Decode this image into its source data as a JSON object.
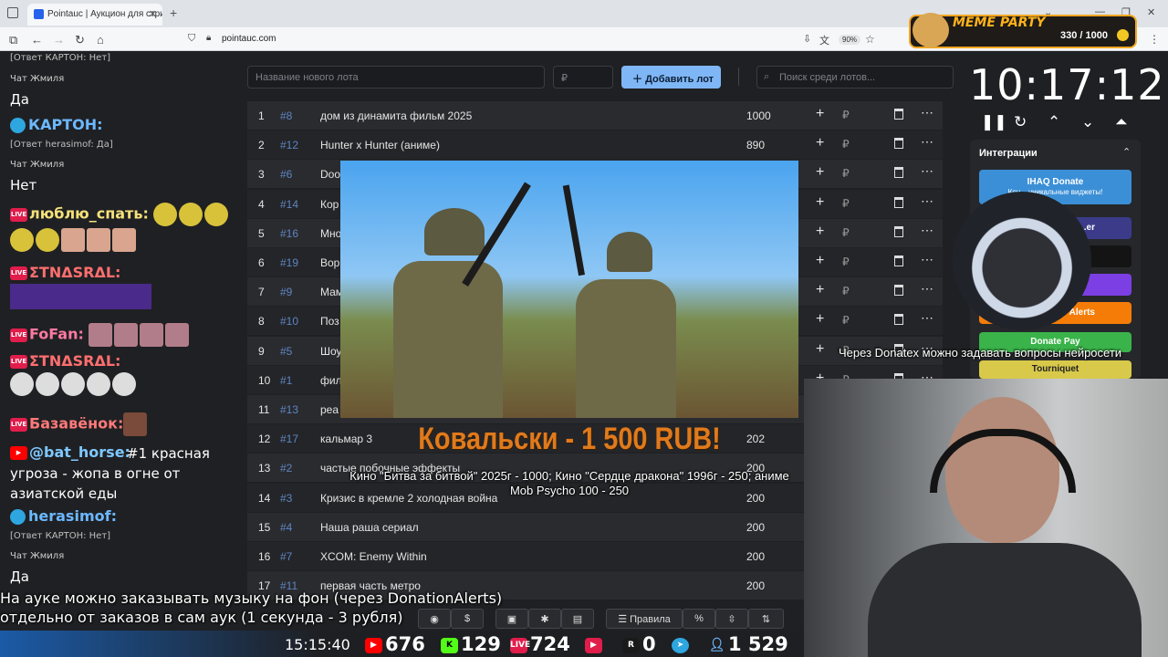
{
  "browser": {
    "tab_title": "Pointauc | Аукцион для стрим",
    "url": "pointauc.com",
    "zoom": "90%"
  },
  "meme_party": {
    "title": "MEME PARTY",
    "counter": "330 / 1000"
  },
  "form": {
    "lot_name_placeholder": "Название нового лота",
    "amount_placeholder": "₽",
    "add_button": "Добавить лот",
    "search_placeholder": "Поиск среди лотов..."
  },
  "lots": [
    {
      "idx": "1",
      "id": "#8",
      "name": "дом из динамита фильм 2025",
      "amount": "1000"
    },
    {
      "idx": "2",
      "id": "#12",
      "name": "Hunter x Hunter (аниме)",
      "amount": "890"
    },
    {
      "idx": "3",
      "id": "#6",
      "name": "Doo",
      "amount": ""
    },
    {
      "idx": "4",
      "id": "#14",
      "name": "Кор",
      "amount": ""
    },
    {
      "idx": "5",
      "id": "#16",
      "name": "Мно",
      "amount": ""
    },
    {
      "idx": "6",
      "id": "#19",
      "name": "Вор",
      "amount": ""
    },
    {
      "idx": "7",
      "id": "#9",
      "name": "Мам",
      "amount": ""
    },
    {
      "idx": "8",
      "id": "#10",
      "name": "Поз",
      "amount": ""
    },
    {
      "idx": "9",
      "id": "#5",
      "name": "Шоу",
      "amount": ""
    },
    {
      "idx": "10",
      "id": "#1",
      "name": "фил",
      "amount": ""
    },
    {
      "idx": "11",
      "id": "#13",
      "name": "реа",
      "amount": ""
    },
    {
      "idx": "12",
      "id": "#17",
      "name": "кальмар 3",
      "amount": "202"
    },
    {
      "idx": "13",
      "id": "#2",
      "name": "частые побочные эффекты",
      "amount": "200"
    },
    {
      "idx": "14",
      "id": "#3",
      "name": "Кризис в кремле 2 холодная война",
      "amount": "200"
    },
    {
      "idx": "15",
      "id": "#4",
      "name": "Наша раша сериал",
      "amount": "200"
    },
    {
      "idx": "16",
      "id": "#7",
      "name": "XCOM: Enemy Within",
      "amount": "200"
    },
    {
      "idx": "17",
      "id": "#11",
      "name": "первая часть метро",
      "amount": "200"
    }
  ],
  "currency_symbol": "₽",
  "donation": {
    "title": "Ковальски - 1 500 RUB!",
    "message": "Кино \"Битва за битвой\" 2025г - 1000; Кино \"Сердце дракона\" 1996г - 250; аниме Mob Psycho 100 - 250"
  },
  "timer": {
    "value": "10:17:12"
  },
  "integrations": {
    "title": "Интеграции",
    "buttons": [
      "IHAQ Donate",
      "Кон... уникальные виджеты!",
      "...er",
      "",
      "",
      "Alerts",
      "Donate Pay",
      "Tourniquet"
    ]
  },
  "overlay_question": "Через Donatex можно задавать вопросы нейросети",
  "chat": [
    {
      "type": "sys",
      "text": "[Ответ КАРТОН: Нет]"
    },
    {
      "type": "name",
      "text": "Чат Жмиля"
    },
    {
      "type": "msg",
      "text": "Да"
    },
    {
      "type": "user",
      "text": "КАРТОН:"
    },
    {
      "type": "sys",
      "text": "[Ответ herasimof: Да]"
    },
    {
      "type": "name",
      "text": "Чат Жмиля"
    },
    {
      "type": "msg",
      "text": "Нет"
    },
    {
      "type": "user",
      "text": "люблю_спать:"
    },
    {
      "type": "user",
      "text": "ΣTNΔSRΔL:"
    },
    {
      "type": "user",
      "text": "FoFan:"
    },
    {
      "type": "user",
      "text": "ΣTNΔSRΔL:"
    },
    {
      "type": "user",
      "text": "Базавёнок:"
    },
    {
      "type": "user",
      "text": "@bat_horse:"
    },
    {
      "type": "msg",
      "text": "#1 красная угроза - жопа в огне от азиатской еды"
    },
    {
      "type": "user",
      "text": "herasimof:"
    },
    {
      "type": "sys",
      "text": "[Ответ КАРТОН: Нет]"
    },
    {
      "type": "name",
      "text": "Чат Жмиля"
    },
    {
      "type": "msg",
      "text": "Да"
    }
  ],
  "music_notice": [
    "На ауке можно заказывать музыку на фон (через DonationAlerts)",
    "отдельно от заказов в сам аук (1 секунда - 3 рубля)"
  ],
  "toolbar": {
    "rules_label": "Правила"
  },
  "stats": {
    "time": "15:15:40",
    "youtube": "676",
    "kick": "129",
    "vkplay": "724",
    "rutube": "0",
    "viewers": "1 529"
  }
}
